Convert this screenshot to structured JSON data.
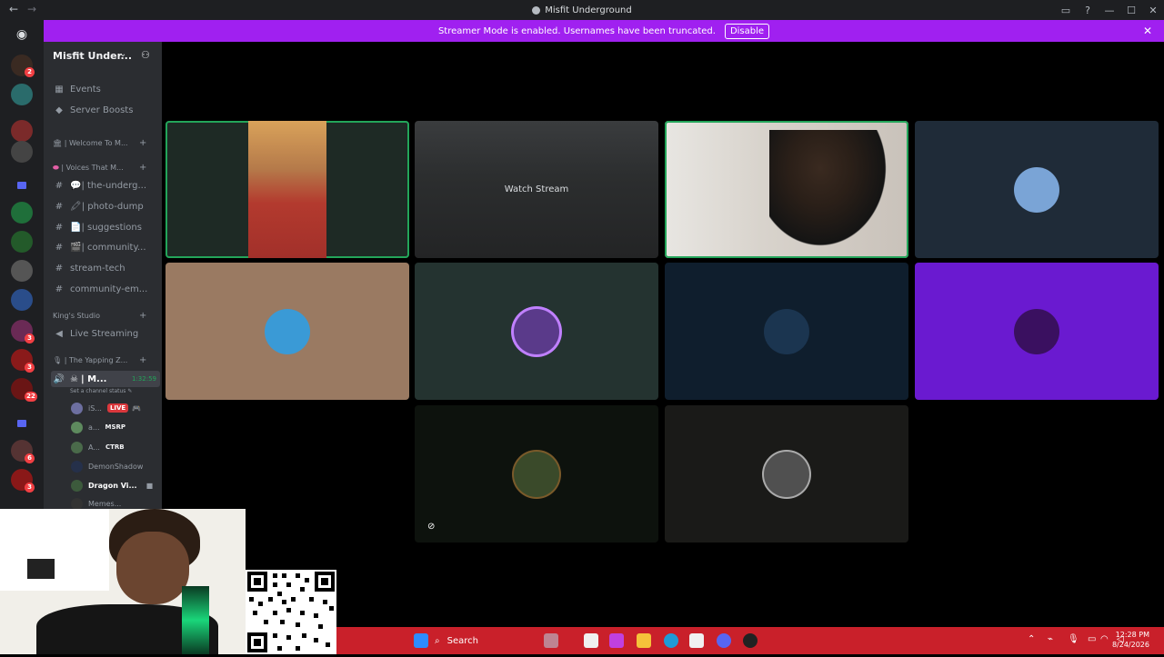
{
  "window": {
    "title": "Misfit Underground",
    "back": "←",
    "forward": "→"
  },
  "banner": {
    "message": "Streamer Mode is enabled. Usernames have been truncated.",
    "disable_label": "Disable",
    "close": "✕"
  },
  "rail": {
    "badges": [
      "2",
      "3",
      "3",
      "22",
      "2",
      "6",
      "3"
    ]
  },
  "server": {
    "name": "Misfit Under...",
    "items": [
      {
        "label": "Events"
      },
      {
        "label": "Server Boosts"
      }
    ],
    "categories": [
      {
        "label": "| Welcome To M..."
      },
      {
        "label": "| Voices That M..."
      },
      {
        "label": "King's Studio"
      },
      {
        "label": "| The Yapping Z..."
      }
    ],
    "channels": [
      {
        "label": "| the-underg...",
        "icon": "💬"
      },
      {
        "label": "| photo-dump",
        "icon": "🖍"
      },
      {
        "label": "| suggestions",
        "icon": "📄"
      },
      {
        "label": "| community...",
        "icon": "🎬"
      },
      {
        "label": "stream-tech",
        "icon": ""
      },
      {
        "label": "community-em...",
        "icon": ""
      },
      {
        "label": "Live Streaming",
        "icon": ""
      }
    ],
    "voice_channel": {
      "label": "| M...",
      "timer": "1:32:59",
      "status": "Set a channel status"
    },
    "voice_users": [
      {
        "name": "iS...",
        "live": "LIVE"
      },
      {
        "name": "a...",
        "tag": "MSRP"
      },
      {
        "name": "A...",
        "tag": "CTRB"
      },
      {
        "name": "DemonShadow"
      },
      {
        "name": "Dragon Vi..."
      },
      {
        "name": "Memes..."
      }
    ]
  },
  "stage": {
    "watch_stream": "Watch Stream"
  },
  "taskbar": {
    "search": "Search",
    "time": "12:28 PM",
    "date": "8/24/2026"
  }
}
